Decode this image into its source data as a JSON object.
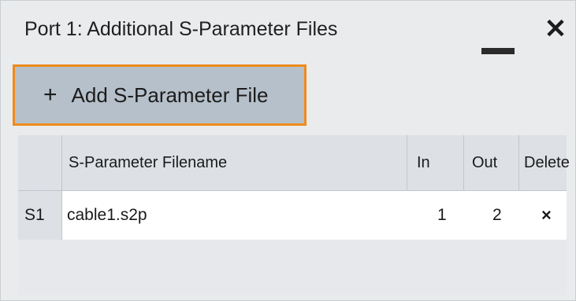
{
  "dialog": {
    "title": "Port 1: Additional S-Parameter Files",
    "minimize_icon": "minimize-icon",
    "close_glyph": "✕"
  },
  "toolbar": {
    "add_plus": "+",
    "add_label": "Add S-Parameter File"
  },
  "table": {
    "headers": {
      "filename": "S-Parameter Filename",
      "in": "In",
      "out": "Out",
      "delete": "Delete"
    },
    "rows": [
      {
        "label": "S1",
        "filename": "cable1.s2p",
        "in": "1",
        "out": "2",
        "delete": "×"
      }
    ]
  },
  "colors": {
    "focus_border": "#f08a1c",
    "button_bg": "#b6c0ca",
    "background": "#e9ebed"
  }
}
